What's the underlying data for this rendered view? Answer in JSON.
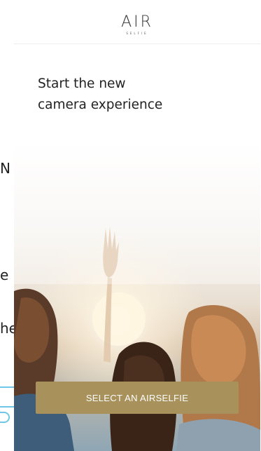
{
  "background": {
    "fragments": [
      "N",
      "e",
      "he"
    ]
  },
  "app": {
    "logo": "AIR",
    "logo_sub": "SELFIE"
  },
  "headline": {
    "line1": "Start the new",
    "line2": "camera experience"
  },
  "cta": {
    "label": "SELECT AN AIRSELFIE"
  },
  "colors": {
    "cta_background": "#a8915a",
    "cta_text": "#ffffff",
    "accent_outline": "#6fc6e6"
  }
}
